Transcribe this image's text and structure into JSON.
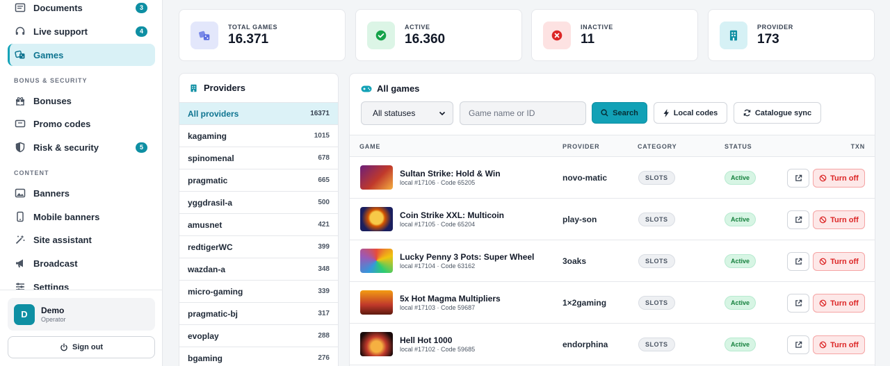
{
  "sidebar": {
    "items": [
      {
        "label": "Documents",
        "icon": "document-icon",
        "badge": "3"
      },
      {
        "label": "Live support",
        "icon": "headset-icon",
        "badge": "4"
      },
      {
        "label": "Games",
        "icon": "dice-icon",
        "active": true
      },
      {
        "label": "Bonuses",
        "icon": "gift-icon"
      },
      {
        "label": "Promo codes",
        "icon": "ticket-icon"
      },
      {
        "label": "Risk & security",
        "icon": "shield-icon",
        "badge": "5"
      },
      {
        "label": "Banners",
        "icon": "image-icon"
      },
      {
        "label": "Mobile banners",
        "icon": "phone-icon"
      },
      {
        "label": "Site assistant",
        "icon": "wand-icon"
      },
      {
        "label": "Broadcast",
        "icon": "megaphone-icon"
      },
      {
        "label": "Settings",
        "icon": "sliders-icon"
      }
    ],
    "sections": {
      "bonus_security": "BONUS & SECURITY",
      "content": "CONTENT"
    },
    "user": {
      "initial": "D",
      "name": "Demo",
      "role": "Operator"
    },
    "sign_out": "Sign out"
  },
  "stats": [
    {
      "label": "TOTAL GAMES",
      "value": "16.371",
      "icon": "dice-icon",
      "color": "#5b6ee1"
    },
    {
      "label": "ACTIVE",
      "value": "16.360",
      "icon": "check-circle-icon",
      "color": "#16a34a"
    },
    {
      "label": "INACTIVE",
      "value": "11",
      "icon": "x-circle-icon",
      "color": "#dc2626"
    },
    {
      "label": "PROVIDER",
      "value": "173",
      "icon": "building-icon",
      "color": "#0e8fa3"
    }
  ],
  "providers": {
    "title": "Providers",
    "items": [
      {
        "name": "All providers",
        "count": "16371"
      },
      {
        "name": "kagaming",
        "count": "1015"
      },
      {
        "name": "spinomenal",
        "count": "678"
      },
      {
        "name": "pragmatic",
        "count": "665"
      },
      {
        "name": "yggdrasil-a",
        "count": "500"
      },
      {
        "name": "amusnet",
        "count": "421"
      },
      {
        "name": "redtigerWC",
        "count": "399"
      },
      {
        "name": "wazdan-a",
        "count": "348"
      },
      {
        "name": "micro-gaming",
        "count": "339"
      },
      {
        "name": "pragmatic-bj",
        "count": "317"
      },
      {
        "name": "evoplay",
        "count": "288"
      },
      {
        "name": "bgaming",
        "count": "276"
      }
    ]
  },
  "games": {
    "title": "All games",
    "status_filter": "All statuses",
    "search_placeholder": "Game name or ID",
    "search_button": "Search",
    "local_codes_button": "Local codes",
    "catalogue_sync_button": "Catalogue sync",
    "columns": {
      "game": "GAME",
      "provider": "PROVIDER",
      "category": "CATEGORY",
      "status": "STATUS",
      "txn": "TXN"
    },
    "rows": [
      {
        "name": "Sultan Strike: Hold & Win",
        "meta": "local #17106 · Code 65205",
        "provider": "novo-matic",
        "category": "SLOTS",
        "status": "Active",
        "action": "Turn off"
      },
      {
        "name": "Coin Strike XXL: Multicoin",
        "meta": "local #17105 · Code 65204",
        "provider": "play-son",
        "category": "SLOTS",
        "status": "Active",
        "action": "Turn off"
      },
      {
        "name": "Lucky Penny 3 Pots: Super Wheel",
        "meta": "local #17104 · Code 63162",
        "provider": "3oaks",
        "category": "SLOTS",
        "status": "Active",
        "action": "Turn off"
      },
      {
        "name": "5x Hot Magma Multipliers",
        "meta": "local #17103 · Code 59687",
        "provider": "1×2gaming",
        "category": "SLOTS",
        "status": "Active",
        "action": "Turn off"
      },
      {
        "name": "Hell Hot 1000",
        "meta": "local #17102 · Code 59685",
        "provider": "endorphina",
        "category": "SLOTS",
        "status": "Active",
        "action": "Turn off"
      }
    ]
  }
}
